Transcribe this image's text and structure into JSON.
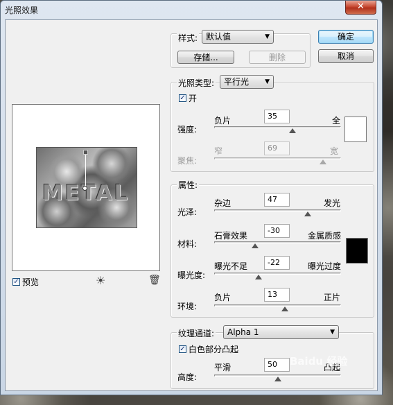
{
  "window": {
    "title": "光照效果",
    "close_glyph": "✕"
  },
  "buttons": {
    "ok": "确定",
    "cancel": "取消",
    "save": "存储...",
    "delete": "删除"
  },
  "style": {
    "label": "样式:",
    "value": "默认值"
  },
  "light_type": {
    "label": "光照类型:",
    "value": "平行光",
    "on_label": "开",
    "on_checked": true
  },
  "intensity": {
    "label": "强度:",
    "left": "负片",
    "right": "全",
    "value": "35",
    "fraction": 0.62,
    "swatch_color": "#ffffff"
  },
  "focus": {
    "label": "聚焦:",
    "left": "窄",
    "right": "宽",
    "value": "69",
    "fraction": 0.86
  },
  "properties": {
    "title": "属性:",
    "gloss": {
      "label": "光泽:",
      "left": "杂边",
      "right": "发光",
      "value": "47",
      "fraction": 0.74
    },
    "material": {
      "label": "材料:",
      "left": "石膏效果",
      "right": "金属质感",
      "value": "-30",
      "fraction": 0.32
    },
    "exposure": {
      "label": "曝光度:",
      "left": "曝光不足",
      "right": "曝光过度",
      "value": "-22",
      "fraction": 0.35
    },
    "ambience": {
      "label": "环境:",
      "left": "负片",
      "right": "正片",
      "value": "13",
      "fraction": 0.56
    },
    "swatch_color": "#000000"
  },
  "texture": {
    "label": "纹理通道:",
    "value": "Alpha 1",
    "white_high_label": "白色部分凸起",
    "white_high_checked": true,
    "height": {
      "label": "高度:",
      "left": "平滑",
      "right": "凸起",
      "value": "50",
      "fraction": 0.5
    }
  },
  "preview": {
    "label": "预览",
    "checked": true,
    "image_text": "METAL"
  },
  "watermark": "Baidu 经验",
  "icons": {
    "checkmark": "✓",
    "dropdown": "▼",
    "light_bulb": "☀",
    "trash": "🗑"
  }
}
